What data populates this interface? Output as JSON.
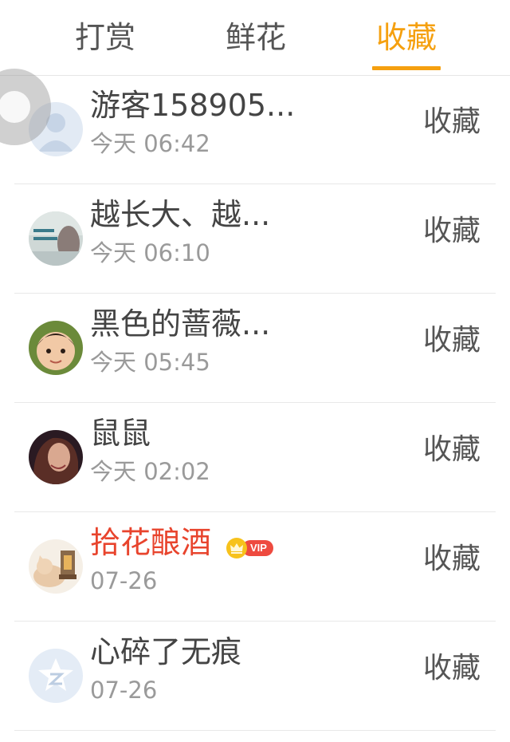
{
  "tabs": [
    {
      "label": "打赏",
      "active": false
    },
    {
      "label": "鲜花",
      "active": false
    },
    {
      "label": "收藏",
      "active": true
    }
  ],
  "accent_color": "#f5a00f",
  "vip_name_color": "#e8442d",
  "rows": [
    {
      "name": "游客158905...",
      "time": "今天 06:42",
      "action": "收藏",
      "avatar": "default-user-avatar"
    },
    {
      "name": "越长大、越...",
      "time": "今天 06:10",
      "action": "收藏",
      "avatar": "photo-avatar"
    },
    {
      "name": "黑色的蔷薇...",
      "time": "今天 05:45",
      "action": "收藏",
      "avatar": "child-photo-avatar"
    },
    {
      "name": "鼠鼠",
      "time": "今天 02:02",
      "action": "收藏",
      "avatar": "portrait-photo-avatar"
    },
    {
      "name": "拾花酿酒",
      "time": "07-26",
      "action": "收藏",
      "avatar": "cat-illustration-avatar",
      "vip": true,
      "vip_label": "VIP"
    },
    {
      "name": "心碎了无痕",
      "time": "07-26",
      "action": "收藏",
      "avatar": "qzone-default-avatar"
    }
  ]
}
